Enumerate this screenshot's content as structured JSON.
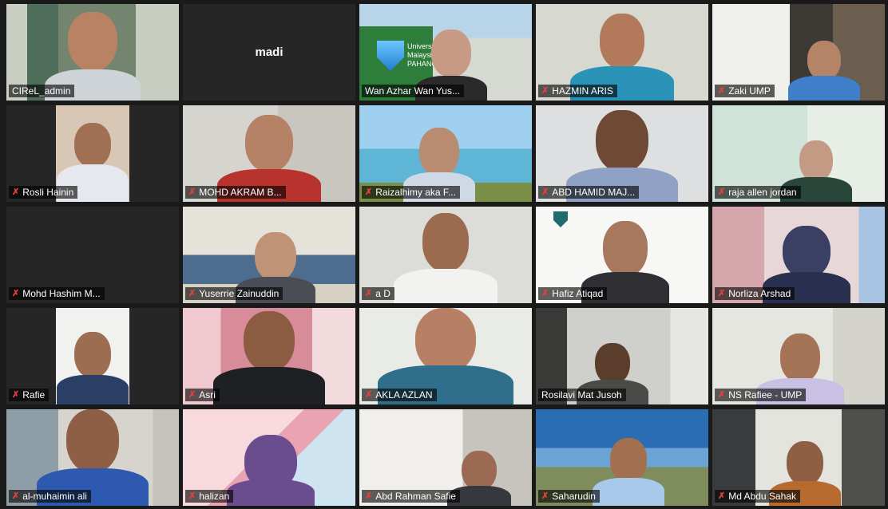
{
  "participants": [
    {
      "name": "CIReL_admin",
      "muted": false
    },
    {
      "name": "madi",
      "muted": false
    },
    {
      "name": "Wan Azhar Wan Yus...",
      "muted": false
    },
    {
      "name": "HAZMIN ARIS",
      "muted": true
    },
    {
      "name": "Zaki UMP",
      "muted": true
    },
    {
      "name": "Rosli Hainin",
      "muted": true
    },
    {
      "name": "MOHD AKRAM B...",
      "muted": true
    },
    {
      "name": "Raizalhimy aka F...",
      "muted": true
    },
    {
      "name": "ABD HAMID MAJ...",
      "muted": true
    },
    {
      "name": "raja allen jordan",
      "muted": true
    },
    {
      "name": "Mohd Hashim M...",
      "muted": true
    },
    {
      "name": "Yuserrie Zainuddin",
      "muted": true
    },
    {
      "name": "a D",
      "muted": true
    },
    {
      "name": "Hafiz Atiqad",
      "muted": true
    },
    {
      "name": "Norliza Arshad",
      "muted": true
    },
    {
      "name": "Rafie",
      "muted": true
    },
    {
      "name": "Asri",
      "muted": true
    },
    {
      "name": "AKLA AZLAN",
      "muted": true
    },
    {
      "name": "Rosilavi Mat Jusoh",
      "muted": false
    },
    {
      "name": "NS Rafiee - UMP",
      "muted": true
    },
    {
      "name": "al-muhaimin ali",
      "muted": true
    },
    {
      "name": "halizan",
      "muted": true
    },
    {
      "name": "Abd Rahman Safie",
      "muted": true
    },
    {
      "name": "Saharudin",
      "muted": true
    },
    {
      "name": "Md Abdu Sahak",
      "muted": true
    }
  ],
  "mic_muted_icon": "✗",
  "active_speaker_color": "#e3d95a",
  "muted_icon_color": "#e5413a",
  "logo_text": "Universiti Malaysia PAHANG"
}
